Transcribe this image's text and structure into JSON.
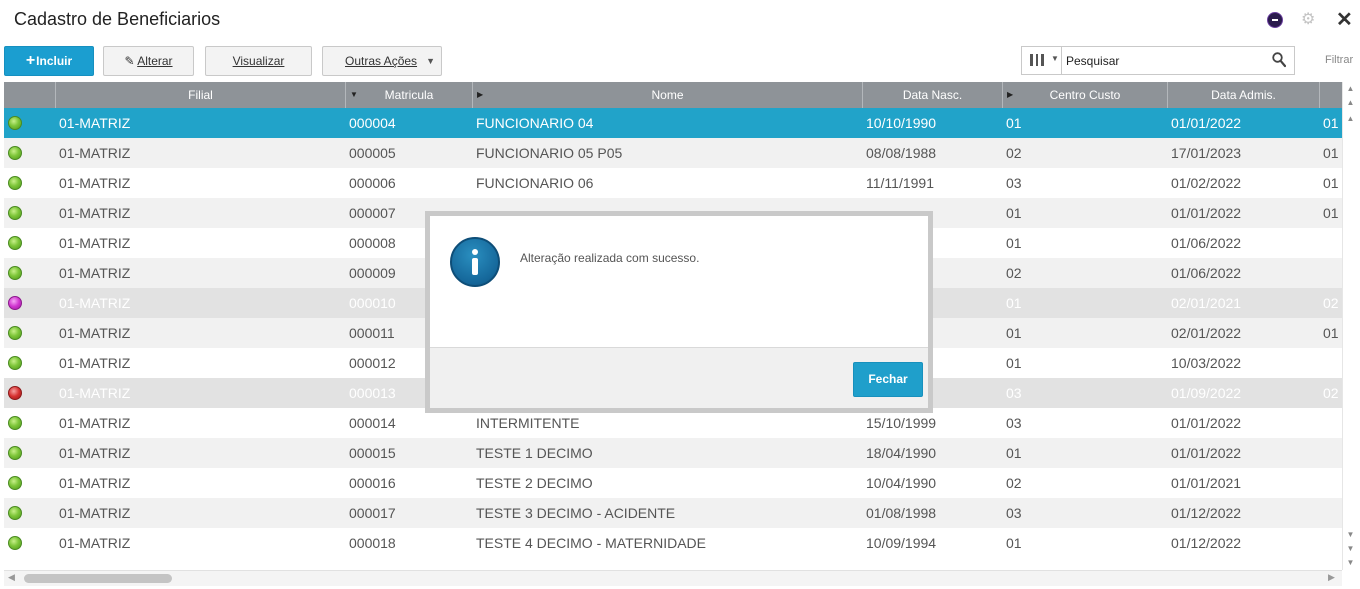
{
  "header": {
    "title": "Cadastro de Beneficiarios"
  },
  "toolbar": {
    "incluir_label": "Incluir",
    "alterar_label": "Alterar",
    "visualizar_label": "Visualizar",
    "outras_label": "Outras Ações"
  },
  "search": {
    "placeholder": "Pesquisar",
    "filter_label": "Filtrar"
  },
  "grid": {
    "columns": [
      "Filial",
      "Matricula",
      "Nome",
      "Data Nasc.",
      "Centro Custo",
      "Data Admis."
    ],
    "rows": [
      {
        "status": "green",
        "filial": "01-MATRIZ",
        "matricula": "000004",
        "nome": "FUNCIONARIO 04",
        "nasc": "10/10/1990",
        "cc": "01",
        "admis": "01/01/2022",
        "extra": "01"
      },
      {
        "status": "green",
        "filial": "01-MATRIZ",
        "matricula": "000005",
        "nome": "FUNCIONARIO 05 P05",
        "nasc": "08/08/1988",
        "cc": "02",
        "admis": "17/01/2023",
        "extra": "01"
      },
      {
        "status": "green",
        "filial": "01-MATRIZ",
        "matricula": "000006",
        "nome": "FUNCIONARIO 06",
        "nasc": "11/11/1991",
        "cc": "03",
        "admis": "01/02/2022",
        "extra": "01"
      },
      {
        "status": "green",
        "filial": "01-MATRIZ",
        "matricula": "000007",
        "nome": "",
        "nasc": "",
        "cc": "01",
        "admis": "01/01/2022",
        "extra": "01"
      },
      {
        "status": "green",
        "filial": "01-MATRIZ",
        "matricula": "000008",
        "nome": "",
        "nasc": "",
        "cc": "01",
        "admis": "01/06/2022",
        "extra": ""
      },
      {
        "status": "green",
        "filial": "01-MATRIZ",
        "matricula": "000009",
        "nome": "",
        "nasc": "",
        "cc": "02",
        "admis": "01/06/2022",
        "extra": ""
      },
      {
        "status": "magenta",
        "filial": "01-MATRIZ",
        "matricula": "000010",
        "nome": "",
        "nasc": "",
        "cc": "01",
        "admis": "02/01/2021",
        "extra": "02"
      },
      {
        "status": "green",
        "filial": "01-MATRIZ",
        "matricula": "000011",
        "nome": "",
        "nasc": "",
        "cc": "01",
        "admis": "02/01/2022",
        "extra": "01"
      },
      {
        "status": "green",
        "filial": "01-MATRIZ",
        "matricula": "000012",
        "nome": "",
        "nasc": "",
        "cc": "01",
        "admis": "10/03/2022",
        "extra": ""
      },
      {
        "status": "red",
        "filial": "01-MATRIZ",
        "matricula": "000013",
        "nome": "",
        "nasc": "",
        "cc": "03",
        "admis": "01/09/2022",
        "extra": "02"
      },
      {
        "status": "green",
        "filial": "01-MATRIZ",
        "matricula": "000014",
        "nome": "INTERMITENTE",
        "nasc": "15/10/1999",
        "cc": "03",
        "admis": "01/01/2022",
        "extra": ""
      },
      {
        "status": "green",
        "filial": "01-MATRIZ",
        "matricula": "000015",
        "nome": "TESTE 1 DECIMO",
        "nasc": "18/04/1990",
        "cc": "01",
        "admis": "01/01/2022",
        "extra": ""
      },
      {
        "status": "green",
        "filial": "01-MATRIZ",
        "matricula": "000016",
        "nome": "TESTE 2 DECIMO",
        "nasc": "10/04/1990",
        "cc": "02",
        "admis": "01/01/2021",
        "extra": ""
      },
      {
        "status": "green",
        "filial": "01-MATRIZ",
        "matricula": "000017",
        "nome": "TESTE 3 DECIMO - ACIDENTE",
        "nasc": "01/08/1998",
        "cc": "03",
        "admis": "01/12/2022",
        "extra": ""
      },
      {
        "status": "green",
        "filial": "01-MATRIZ",
        "matricula": "000018",
        "nome": "TESTE 4 DECIMO - MATERNIDADE",
        "nasc": "10/09/1994",
        "cc": "01",
        "admis": "01/12/2022",
        "extra": ""
      }
    ]
  },
  "dialog": {
    "message": "Alteração realizada com sucesso.",
    "close_label": "Fechar"
  }
}
